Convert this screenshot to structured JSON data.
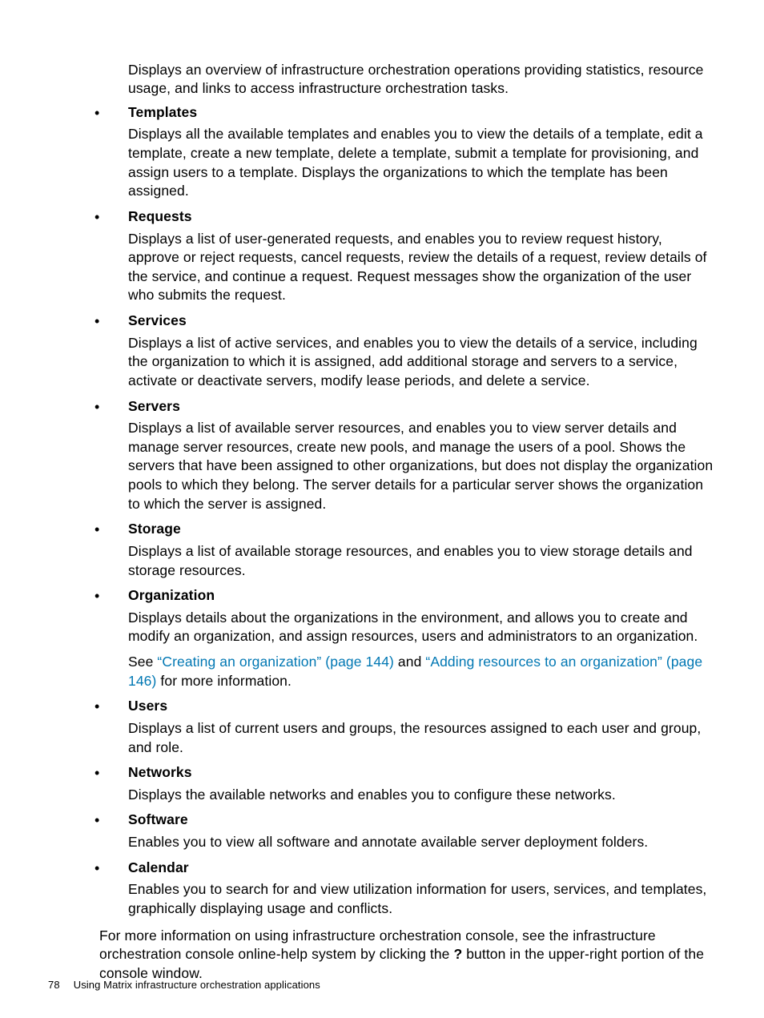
{
  "intro": "Displays an overview of infrastructure orchestration operations providing statistics, resource usage, and links to access infrastructure orchestration tasks.",
  "items": [
    {
      "title": "Templates",
      "body": "Displays all the available templates and enables you to view the details of a template, edit a template, create a new template, delete a template, submit a template for provisioning, and assign users to a template. Displays the organizations to which the template has been assigned."
    },
    {
      "title": "Requests",
      "body": "Displays a list of user-generated requests, and enables you to review request history, approve or reject requests, cancel requests, review the details of a request, review details of the service, and continue a request. Request messages show the organization of the user who submits the request."
    },
    {
      "title": "Services",
      "body": "Displays a list of active services, and enables you to view the details of a service, including the organization to which it is assigned, add additional storage and servers to a service, activate or deactivate servers, modify lease periods, and delete a service."
    },
    {
      "title": "Servers",
      "body": "Displays a list of available server resources, and enables you to view server details and manage server resources, create new pools, and manage the users of a pool. Shows the servers that have been assigned to other organizations, but does not display the organization pools to which they belong. The server details for a particular server shows the organization to which the server is assigned."
    },
    {
      "title": "Storage",
      "body": "Displays a list of available storage resources, and enables you to view storage details and storage resources."
    },
    {
      "title": "Organization",
      "body": "Displays details about the organizations in the environment, and allows you to create and modify an organization, and assign resources, users and administrators to an organization.",
      "extra_pre": "See ",
      "link1": "“Creating an organization” (page 144)",
      "mid": " and ",
      "link2": "“Adding resources to an organization” (page 146)",
      "extra_post": " for more information."
    },
    {
      "title": "Users",
      "body": "Displays a list of current users and groups, the resources assigned to each user and group, and role."
    },
    {
      "title": "Networks",
      "body": "Displays the available networks and enables you to configure these networks."
    },
    {
      "title": "Software",
      "body": "Enables you to view all software and annotate available server deployment folders."
    },
    {
      "title": "Calendar",
      "body": "Enables you to search for and view utilization information for users, services, and templates, graphically displaying usage and conflicts."
    }
  ],
  "closing": {
    "pre": "For more information on using infrastructure orchestration console, see the infrastructure orchestration console online-help system by clicking the ",
    "qmark": "?",
    "post": " button in the upper-right portion of the console window."
  },
  "footer": {
    "page": "78",
    "chapter": "Using Matrix infrastructure orchestration applications"
  }
}
